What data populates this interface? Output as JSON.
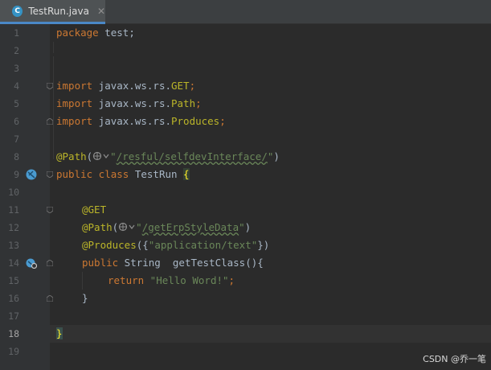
{
  "tab": {
    "icon_letter": "C",
    "file_name": "TestRun.java",
    "close_glyph": "✕"
  },
  "line_numbers": [
    "1",
    "2",
    "3",
    "4",
    "5",
    "6",
    "7",
    "8",
    "9",
    "10",
    "11",
    "12",
    "13",
    "14",
    "15",
    "16",
    "17",
    "18",
    "19"
  ],
  "code": {
    "l1_kw": "package",
    "l1_rest": " test;",
    "l4_kw": "import",
    "l4_pkg": " javax.ws.rs.",
    "l4_cls": "GET",
    "l4_end": ";",
    "l5_kw": "import",
    "l5_pkg": " javax.ws.rs.",
    "l5_cls": "Path",
    "l5_end": ";",
    "l6_kw": "import",
    "l6_pkg": " javax.ws.rs.",
    "l6_cls": "Produces",
    "l6_end": ";",
    "l8_ann": "@Path",
    "l8_open": "(",
    "l8_q1": "\"",
    "l8_url": "/resful/selfdevInterface/",
    "l8_q2": "\"",
    "l8_close": ")",
    "l9_kw1": "public",
    "l9_kw2": " class",
    "l9_name": " TestRun ",
    "l9_brace": "{",
    "l11_ann": "@GET",
    "l12_ann": "@Path",
    "l12_open": "(",
    "l12_q1": "\"",
    "l12_url": "/getErpStyleData",
    "l12_q2": "\"",
    "l12_close": ")",
    "l13_ann": "@Produces",
    "l13_open": "({",
    "l13_str": "\"application/text\"",
    "l13_close": "})",
    "l14_kw": "public",
    "l14_rest": " String  getTestClass(){",
    "l15_kw": "return",
    "l15_str": " \"Hello Word!\"",
    "l15_end": ";",
    "l16_brace": "}",
    "l18_brace": "}"
  },
  "current_line": "18",
  "watermark": "CSDN @乔一笔",
  "colors": {
    "background": "#2b2b2b",
    "keyword": "#cc7832",
    "annotation": "#bbb529",
    "string": "#6a8759",
    "text": "#a9b7c6",
    "line_number": "#606366"
  }
}
